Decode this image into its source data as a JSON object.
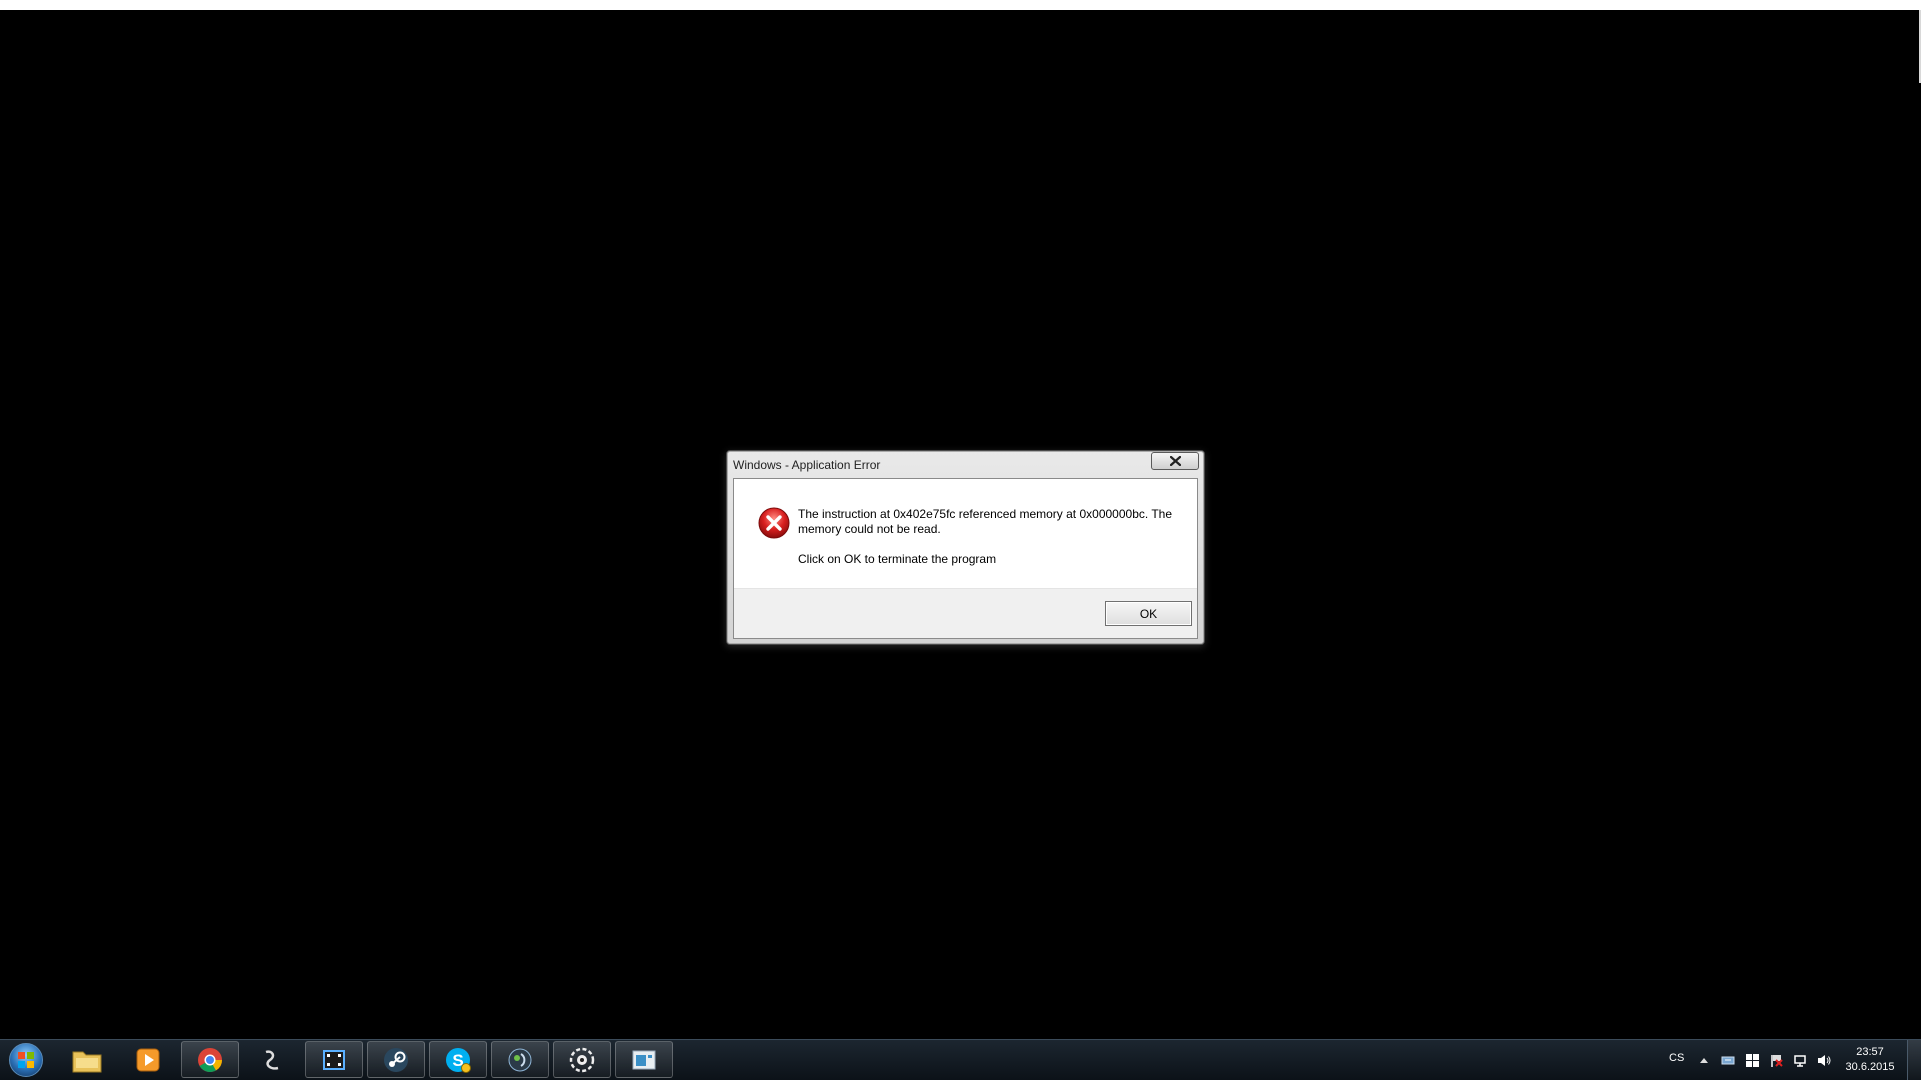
{
  "dialog": {
    "title": "Windows - Application Error",
    "close_glyph": "✕",
    "icon": "error-icon",
    "message_line1": "The instruction at 0x402e75fc referenced memory at 0x000000bc. The memory could not be read.",
    "message_line2": "Click on OK to terminate the program",
    "ok_label": "OK"
  },
  "taskbar": {
    "start_icon": "windows-start-orb",
    "pinned": [
      {
        "name": "file-explorer-icon"
      },
      {
        "name": "media-player-icon"
      },
      {
        "name": "chrome-icon"
      },
      {
        "name": "dota-icon"
      },
      {
        "name": "movie-maker-icon"
      },
      {
        "name": "steam-icon"
      },
      {
        "name": "skype-icon"
      },
      {
        "name": "media-center-icon"
      },
      {
        "name": "gear-app-icon"
      },
      {
        "name": "window-app-icon"
      }
    ],
    "tray": {
      "language": "CS",
      "time": "23:57",
      "date": "30.6.2015"
    }
  }
}
